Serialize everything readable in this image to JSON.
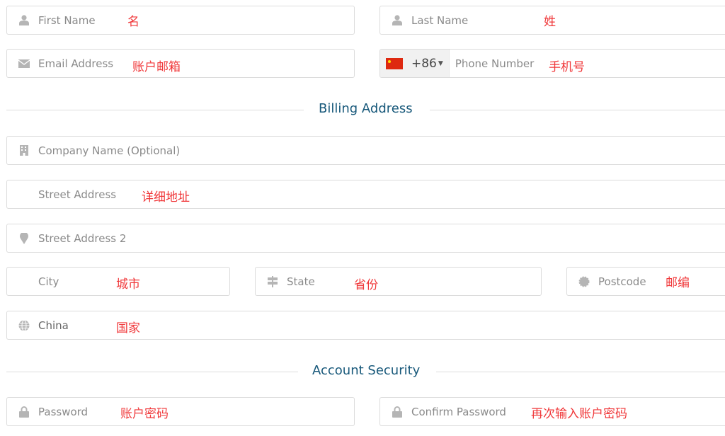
{
  "fields": {
    "first_name": {
      "placeholder": "First Name",
      "note": "名"
    },
    "last_name": {
      "placeholder": "Last Name",
      "note": "姓"
    },
    "email": {
      "placeholder": "Email Address",
      "note": "账户邮箱"
    },
    "phone": {
      "country_code": "+86",
      "placeholder": "Phone Number",
      "note": "手机号"
    },
    "company": {
      "placeholder": "Company Name (Optional)"
    },
    "street": {
      "placeholder": "Street Address",
      "note": "详细地址"
    },
    "street2": {
      "placeholder": "Street Address 2"
    },
    "city": {
      "placeholder": "City",
      "note": "城市"
    },
    "state": {
      "placeholder": "State",
      "note": "省份"
    },
    "postcode": {
      "placeholder": "Postcode",
      "note": "邮编"
    },
    "country": {
      "value": "China",
      "note": "国家"
    },
    "password": {
      "placeholder": "Password",
      "note": "账户密码"
    },
    "confirm_password": {
      "placeholder": "Confirm Password",
      "note": "再次输入账户密码"
    }
  },
  "sections": {
    "billing": "Billing Address",
    "security": "Account Security"
  },
  "colors": {
    "annotation": "#f0383a",
    "heading": "#17587a",
    "icon": "#b5b5b5"
  }
}
